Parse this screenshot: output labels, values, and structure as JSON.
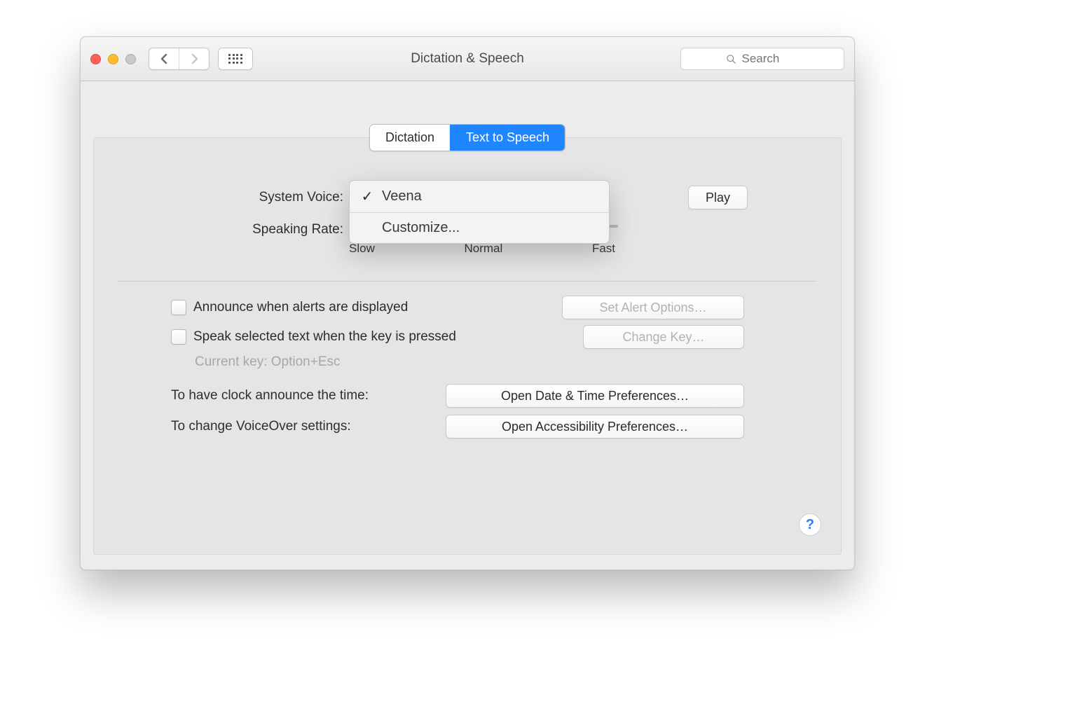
{
  "window": {
    "title": "Dictation & Speech"
  },
  "search": {
    "placeholder": "Search"
  },
  "tabs": {
    "dictation": "Dictation",
    "tts": "Text to Speech"
  },
  "voice": {
    "label": "System Voice:",
    "menu": {
      "selected": "Veena",
      "customize": "Customize..."
    }
  },
  "rate": {
    "label": "Speaking Rate:",
    "ticks": {
      "slow": "Slow",
      "normal": "Normal",
      "fast": "Fast"
    }
  },
  "play_label": "Play",
  "alerts": {
    "announce": "Announce when alerts are displayed",
    "set_options": "Set Alert Options…"
  },
  "speak": {
    "label": "Speak selected text when the key is pressed",
    "current_key": "Current key: Option+Esc",
    "change_key": "Change Key…"
  },
  "links": {
    "clock_label": "To have clock announce the time:",
    "clock_button": "Open Date & Time Preferences…",
    "voiceover_label": "To change VoiceOver settings:",
    "voiceover_button": "Open Accessibility Preferences…"
  },
  "help_symbol": "?"
}
